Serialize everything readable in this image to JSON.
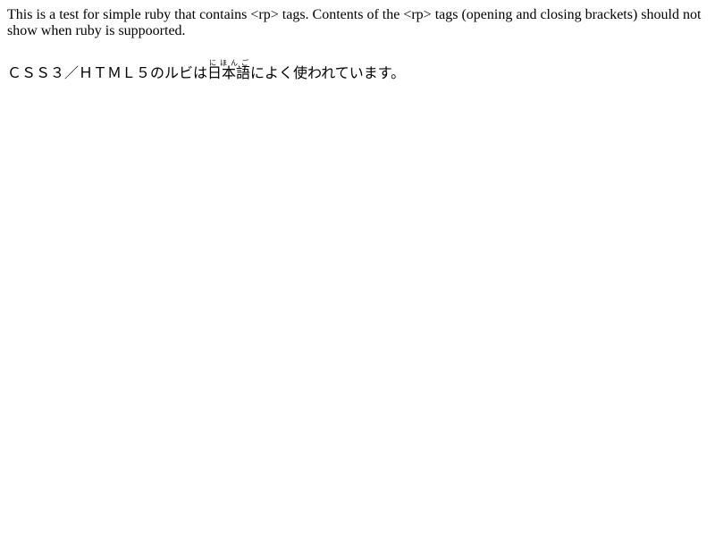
{
  "intro_text": "This is a test for simple ruby that contains <rp> tags. Contents of the <rp> tags (opening and closing brackets) should not show when ruby is suppoorted.",
  "ruby_sentence": {
    "before": "ＣＳＳ３／ＨＴＭＬ５のルビは",
    "base": "日本語",
    "rp_open": "（",
    "annotation": "にほんご",
    "rp_close": "）",
    "after": "によく使われています。"
  }
}
